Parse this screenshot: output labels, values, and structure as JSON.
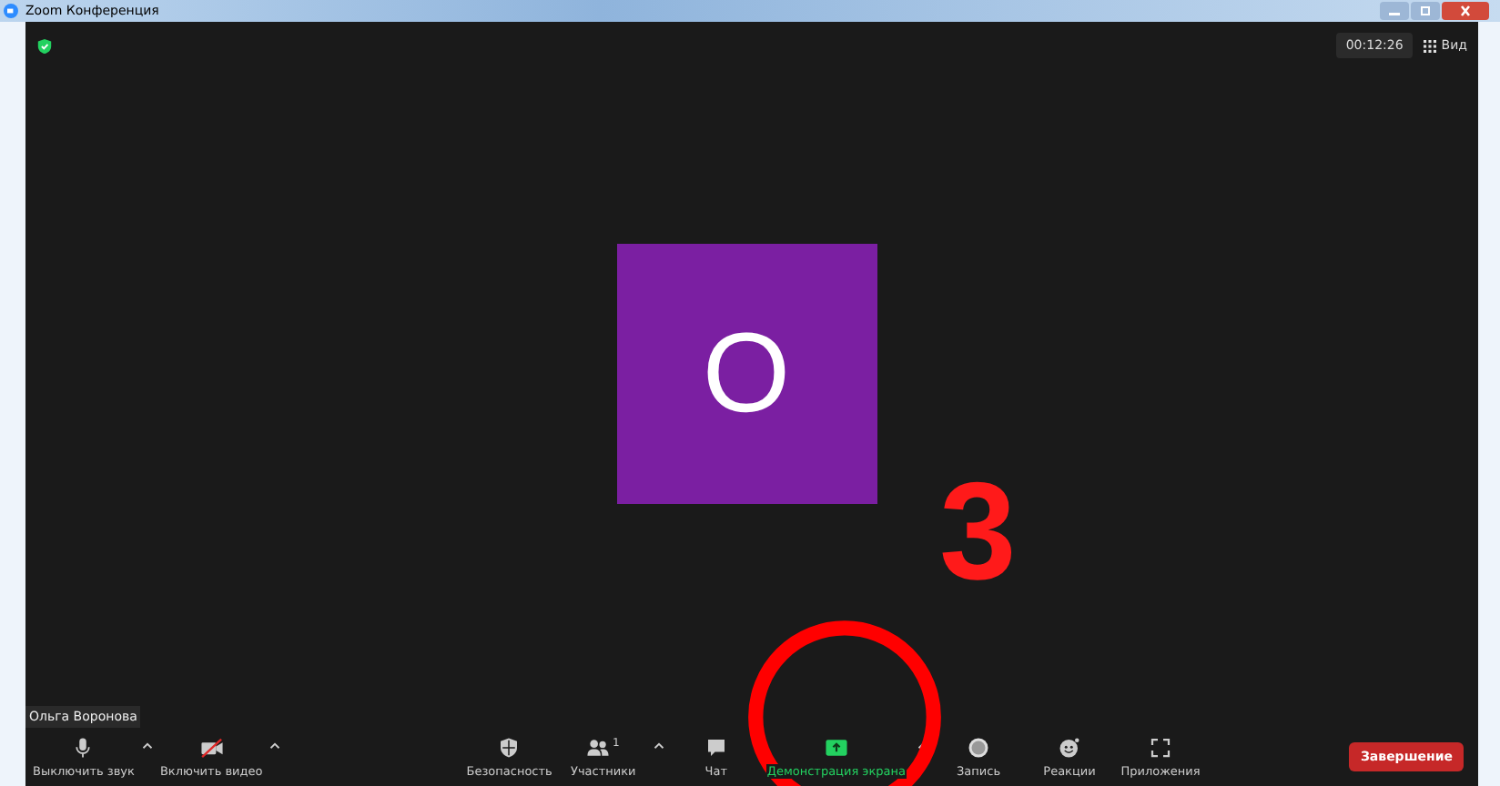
{
  "window": {
    "title": "Zoom Конференция"
  },
  "top_bar": {
    "timer": "00:12:26",
    "view_label": "Вид"
  },
  "participant": {
    "initial": "O",
    "name": "Ольга Воронова"
  },
  "toolbar": [
    {
      "kind": "mic",
      "label": "Выключить звук",
      "menu": true,
      "highlighted": false
    },
    {
      "kind": "video",
      "label": "Включить видео",
      "menu": true,
      "highlighted": false,
      "muted": true
    },
    {
      "kind": "security",
      "label": "Безопасность",
      "menu": false,
      "highlighted": false
    },
    {
      "kind": "participants",
      "label": "Участники",
      "menu": true,
      "highlighted": false,
      "count": "1"
    },
    {
      "kind": "chat",
      "label": "Чат",
      "menu": false,
      "highlighted": false
    },
    {
      "kind": "share",
      "label": "Демонстрация экрана",
      "menu": true,
      "highlighted": true
    },
    {
      "kind": "record",
      "label": "Запись",
      "menu": false,
      "highlighted": false
    },
    {
      "kind": "reactions",
      "label": "Реакции",
      "menu": false,
      "highlighted": false
    },
    {
      "kind": "apps",
      "label": "Приложения",
      "menu": false,
      "highlighted": false
    }
  ],
  "end_button": "Завершение",
  "annotation": {
    "label": "3"
  }
}
